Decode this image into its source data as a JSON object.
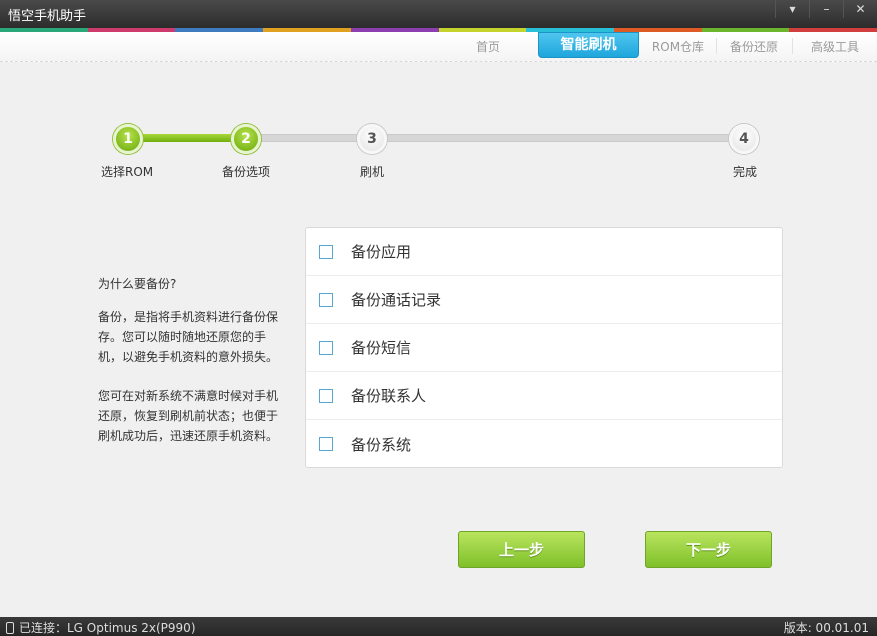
{
  "app": {
    "title": "悟空手机助手"
  },
  "window_controls": {
    "menu": "▾",
    "minimize": "–",
    "close": "✕"
  },
  "stripe_colors": [
    "#2aa87a",
    "#cc3b6b",
    "#3e7bbf",
    "#e0a020",
    "#8d3fb0",
    "#c4d42c",
    "#2abfd8",
    "#de5b26",
    "#6bb62c",
    "#d13e3e"
  ],
  "nav": {
    "home": "首页",
    "smart_flash": "智能刷机",
    "rom_store": "ROM仓库",
    "backup_restore": "备份还原",
    "advanced_tools": "高级工具"
  },
  "steps": [
    {
      "number": "1",
      "label": "选择ROM",
      "state": "done"
    },
    {
      "number": "2",
      "label": "备份选项",
      "state": "done"
    },
    {
      "number": "3",
      "label": "刷机",
      "state": "todo"
    },
    {
      "number": "4",
      "label": "完成",
      "state": "todo"
    }
  ],
  "info": {
    "heading": "为什么要备份?",
    "para1": [
      "备份，是指将手机资料进行备份保",
      "存。您可以随时随地还原您的手",
      "机，以避免手机资料的意外损失。"
    ],
    "para2": [
      "您可在对新系统不满意时候对手机",
      "还原，恢复到刷机前状态；也便于",
      "刷机成功后，迅速还原手机资料。"
    ]
  },
  "options": [
    {
      "label": "备份应用",
      "checked": false
    },
    {
      "label": "备份通话记录",
      "checked": false
    },
    {
      "label": "备份短信",
      "checked": false
    },
    {
      "label": "备份联系人",
      "checked": false
    },
    {
      "label": "备份系统",
      "checked": false
    }
  ],
  "buttons": {
    "prev": "上一步",
    "next": "下一步"
  },
  "status": {
    "connection": "已连接：LG Optimus 2x(P990)",
    "version": "版本: 00.01.01"
  },
  "colors": {
    "accent_green": "#7fc02a",
    "accent_blue": "#1ea6dc"
  }
}
